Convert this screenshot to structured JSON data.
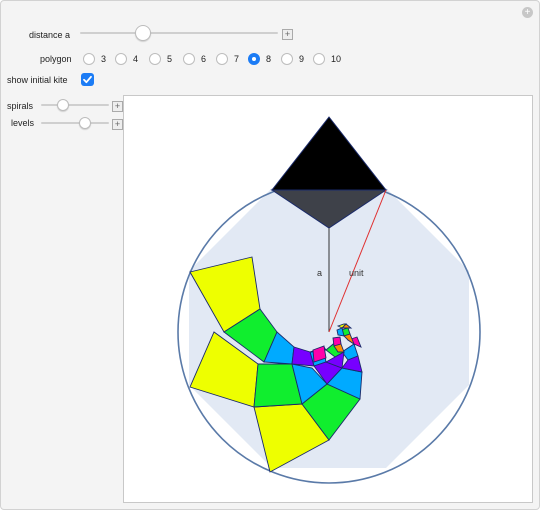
{
  "controls": {
    "distance_label": "distance a",
    "polygon_label": "polygon",
    "polygon_options": [
      "3",
      "4",
      "5",
      "6",
      "7",
      "8",
      "9",
      "10"
    ],
    "polygon_selected": "8",
    "show_kite_label": "show initial kite",
    "show_kite_checked": true,
    "spirals_label": "spirals",
    "levels_label": "levels",
    "distance_value_fraction": 0.32,
    "spirals_value_fraction": 0.33,
    "levels_value_fraction": 0.65
  },
  "plot": {
    "label_a": "a",
    "label_unit": "unit",
    "colors": {
      "yellow": "#eeff00",
      "green": "#10ee2e",
      "cyan": "#00aaff",
      "purple": "#7700ff",
      "magenta": "#ff00aa",
      "orange": "#ff8c00",
      "octagon_fill": "#e2e9f4",
      "circle_stroke": "#5a7aa8",
      "kite_dark": "#3e4149",
      "radius_line": "#e03030"
    }
  }
}
